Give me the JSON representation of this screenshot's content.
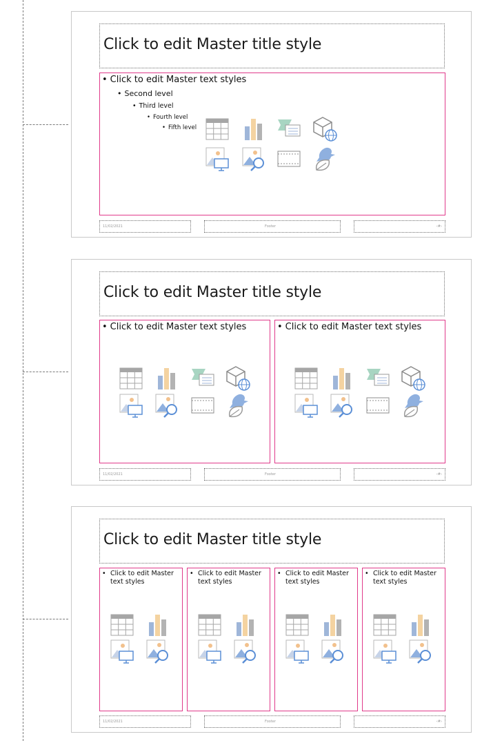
{
  "slides": [
    {
      "title": "Click to edit Master title style",
      "levels": [
        "Click to edit Master text styles",
        "Second level",
        "Third level",
        "Fourth level",
        "Fifth level"
      ],
      "footer": {
        "date": "11/02/2021",
        "footer": "Footer",
        "page": "‹#›"
      }
    },
    {
      "title": "Click to edit Master title style",
      "col1": "Click to edit Master text styles",
      "col2": "Click to edit Master text styles",
      "footer": {
        "date": "11/02/2021",
        "footer": "Footer",
        "page": "‹#›"
      }
    },
    {
      "title": "Click to edit Master title style",
      "cols": [
        "Click to edit Master text styles",
        "Click to edit Master text styles",
        "Click to edit Master text styles",
        "Click to edit Master text styles"
      ],
      "footer": {
        "date": "11/02/2021",
        "footer": "Footer",
        "page": "‹#›"
      }
    }
  ],
  "icons": [
    "insert-table-icon",
    "insert-chart-icon",
    "insert-smartart-icon",
    "insert-3d-model-icon",
    "insert-picture-icon",
    "online-pictures-icon",
    "insert-video-icon",
    "insert-icons-icon"
  ],
  "colors": {
    "placeholder_border": "#e0398a",
    "table_header": "#a6a6a6",
    "chart_blue": "#9fb6d9",
    "chart_orange": "#f4d3a1",
    "chart_gray": "#b3b3b3",
    "picture_blue": "#8fb0df",
    "picture_orange": "#f2c18d"
  }
}
